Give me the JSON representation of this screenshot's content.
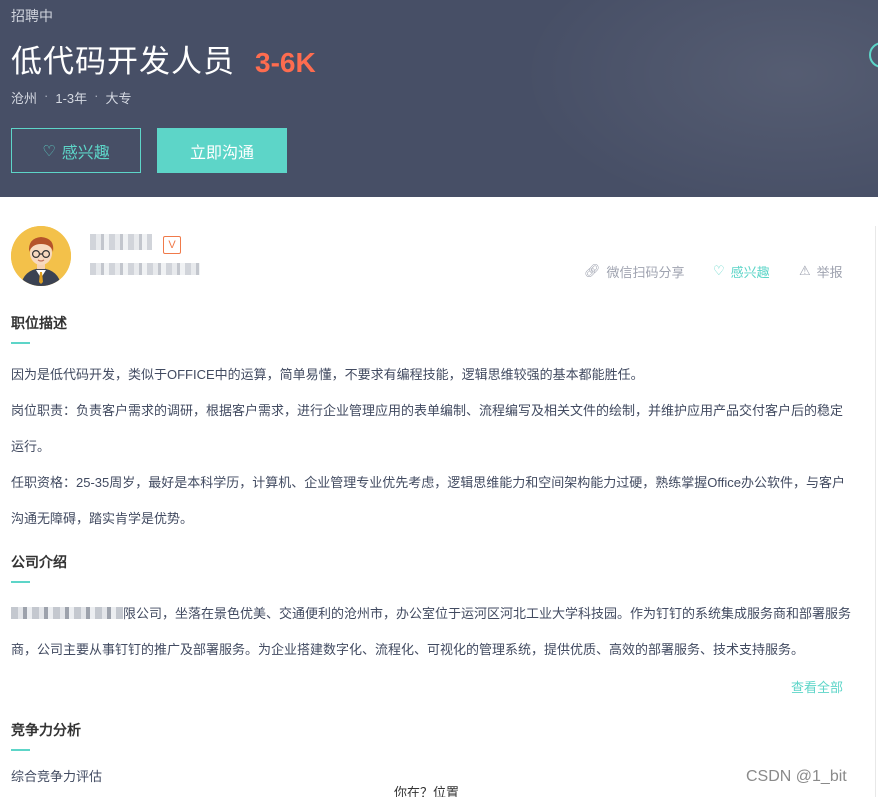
{
  "header": {
    "status": "招聘中",
    "title": "低代码开发人员",
    "salary": "3-6K",
    "meta": {
      "city": "沧州",
      "experience": "1-3年",
      "degree": "大专"
    },
    "interest_button": "感兴趣",
    "chat_button": "立即沟通"
  },
  "recruiter": {
    "share_label": "微信扫码分享",
    "interest_label": "感兴趣",
    "report_label": "举报",
    "badge": "V"
  },
  "job_description": {
    "title": "职位描述",
    "lines": [
      "因为是低代码开发，类似于OFFICE中的运算，简单易懂，不要求有编程技能，逻辑思维较强的基本都能胜任。",
      "岗位职责：负责客户需求的调研，根据客户需求，进行企业管理应用的表单编制、流程编写及相关文件的绘制，并维护应用产品交付客户后的稳定运行。",
      "任职资格：25-35周岁，最好是本科学历，计算机、企业管理专业优先考虑，逻辑思维能力和空间架构能力过硬，熟练掌握Office办公软件，与客户沟通无障碍，踏实肯学是优势。"
    ]
  },
  "company_intro": {
    "title": "公司介绍",
    "text": "限公司，坐落在景色优美、交通便利的沧州市，办公室位于运河区河北工业大学科技园。作为钉钉的系统集成服务商和部署服务商，公司主要从事钉钉的推广及部署服务。为企业搭建数字化、流程化、可视化的管理系统，提供优质、高效的部署服务、技术支持服务。",
    "view_all": "查看全部"
  },
  "competition": {
    "title": "竞争力分析",
    "item": "综合竞争力评估"
  },
  "footer": {
    "where": "你在？位置",
    "watermark": "CSDN @1_bit"
  },
  "colors": {
    "banner": "#474f66",
    "accent": "#5dd5c8",
    "salary": "#fe6c4f"
  },
  "icons": [
    "heart-icon",
    "link-icon",
    "warning-icon"
  ]
}
